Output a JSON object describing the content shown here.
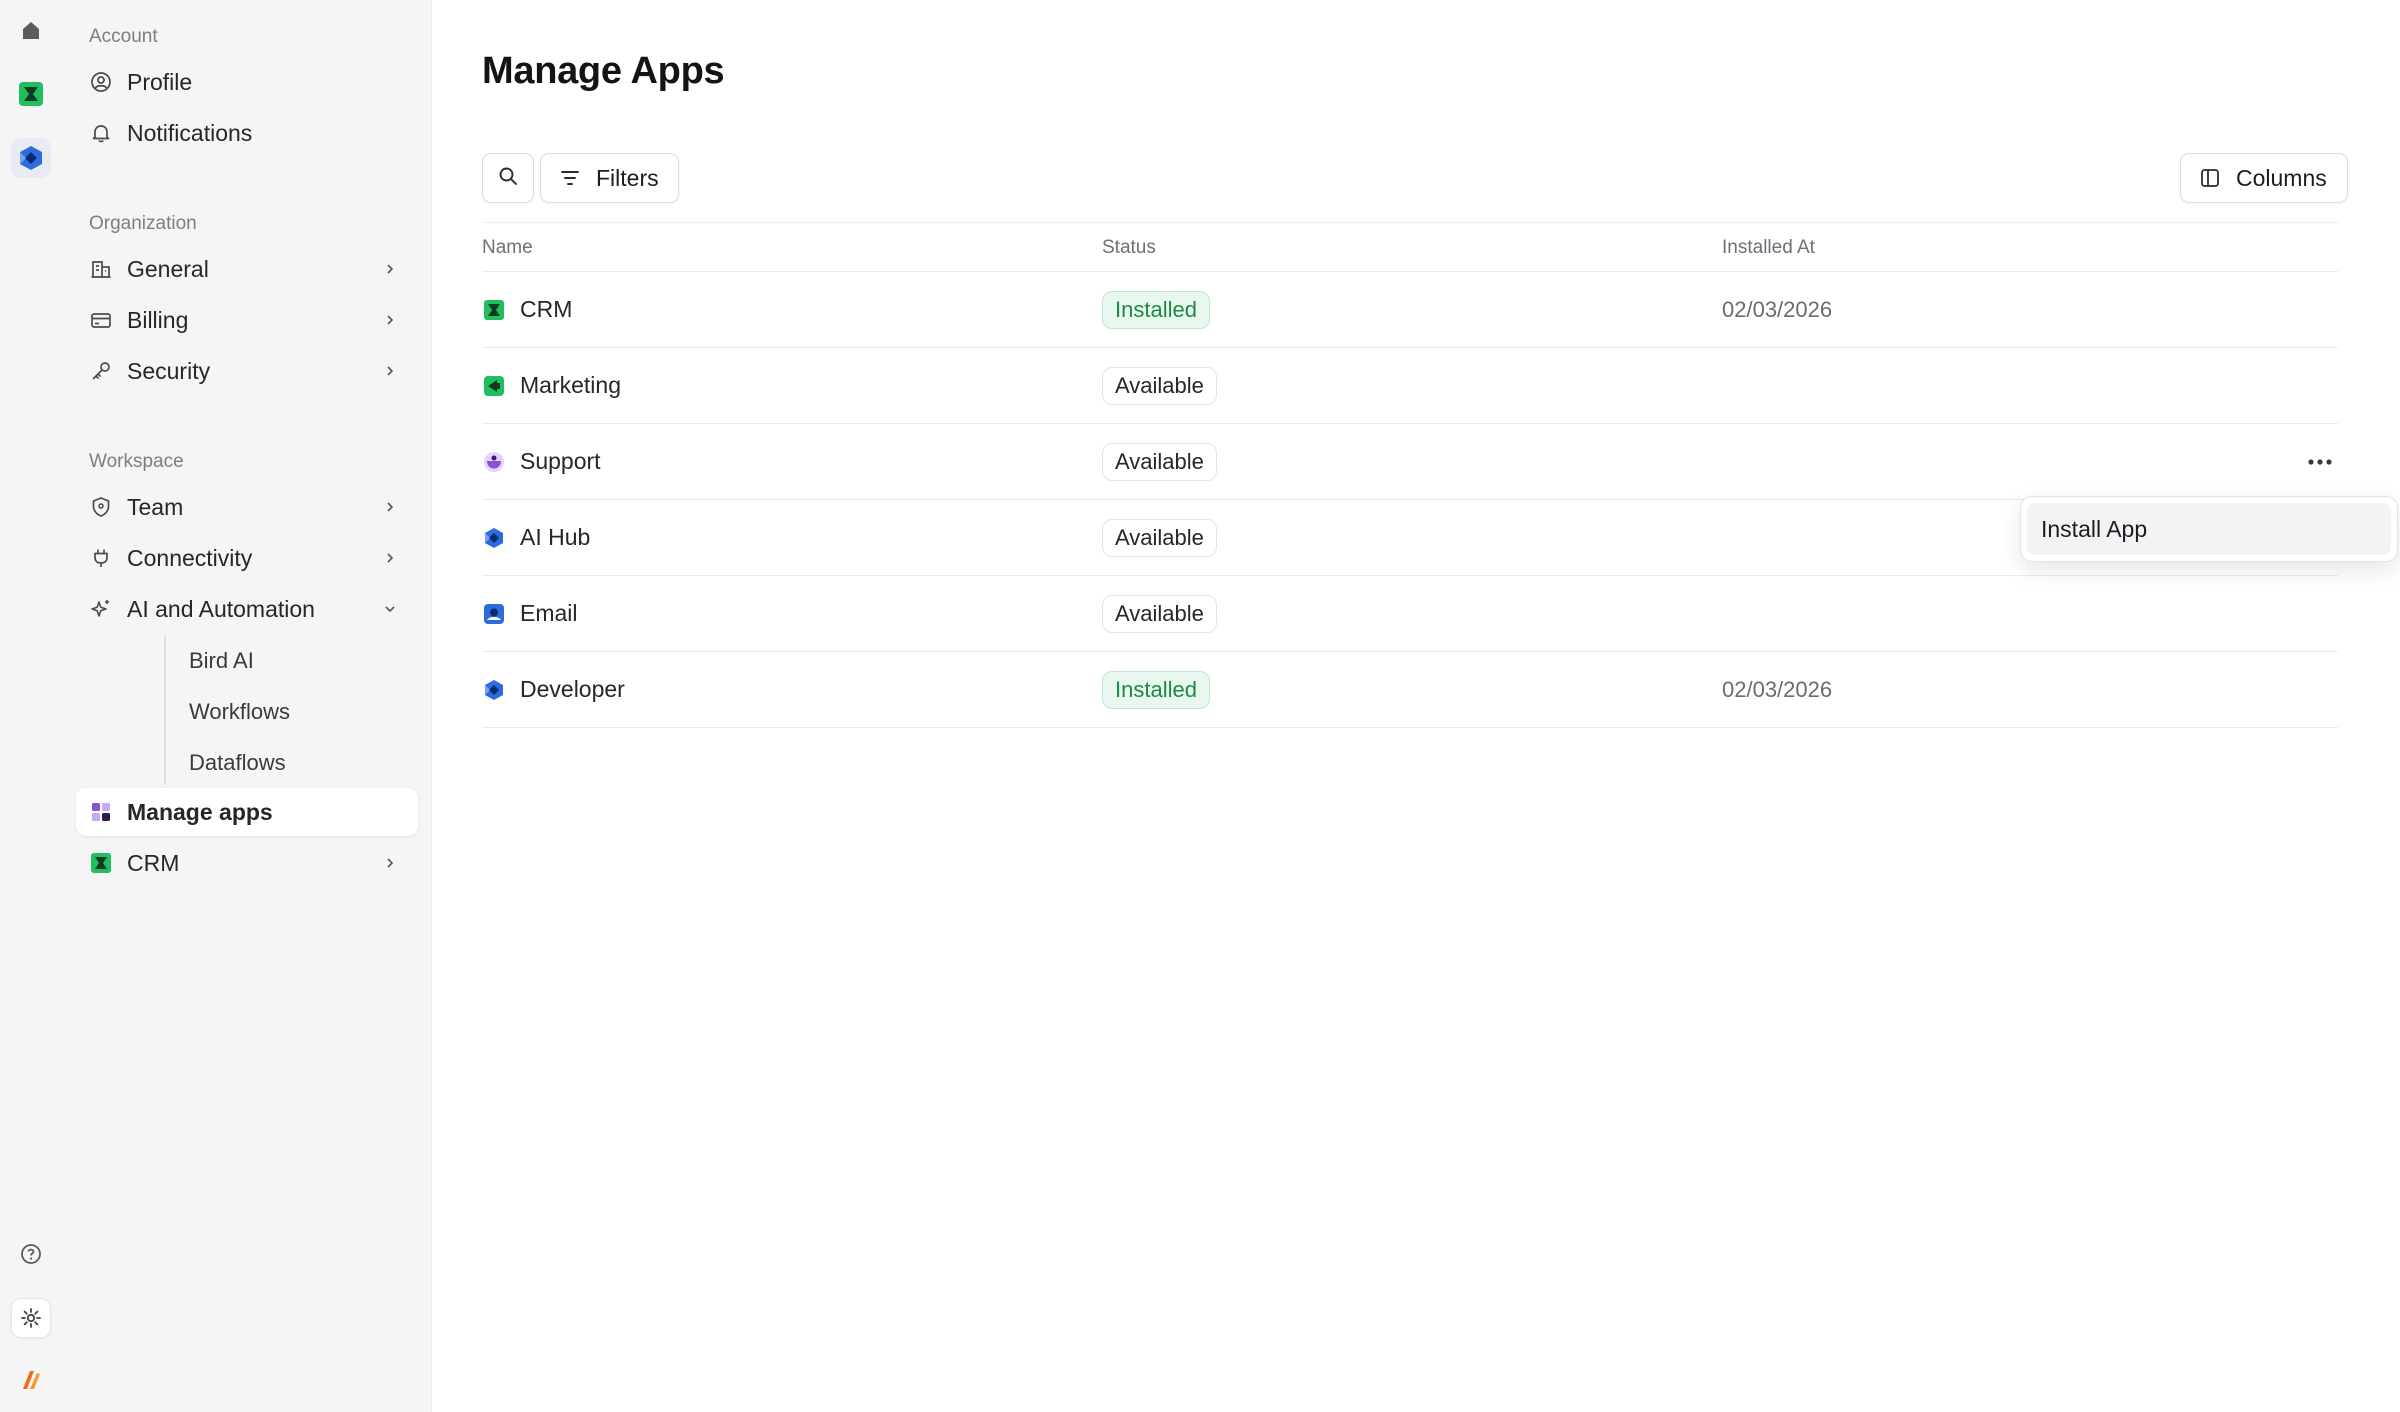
{
  "sidebar": {
    "account_label": "Account",
    "organization_label": "Organization",
    "workspace_label": "Workspace",
    "items": {
      "profile": "Profile",
      "notifications": "Notifications",
      "general": "General",
      "billing": "Billing",
      "security": "Security",
      "team": "Team",
      "connectivity": "Connectivity",
      "ai_automation": "AI and Automation",
      "manage_apps": "Manage apps",
      "crm": "CRM"
    },
    "sub_items": {
      "bird_ai": "Bird AI",
      "workflows": "Workflows",
      "dataflows": "Dataflows"
    }
  },
  "main": {
    "title": "Manage Apps",
    "filters_label": "Filters",
    "columns_label": "Columns",
    "columns": {
      "name": "Name",
      "status": "Status",
      "installed_at": "Installed At"
    },
    "rows": [
      {
        "name": "CRM",
        "status": "Installed",
        "installed_at": "02/03/2026",
        "icon": "crm-app-icon"
      },
      {
        "name": "Marketing",
        "status": "Available",
        "installed_at": "",
        "icon": "marketing-app-icon"
      },
      {
        "name": "Support",
        "status": "Available",
        "installed_at": "",
        "icon": "support-app-icon"
      },
      {
        "name": "AI Hub",
        "status": "Available",
        "installed_at": "",
        "icon": "ai-hub-app-icon"
      },
      {
        "name": "Email",
        "status": "Available",
        "installed_at": "",
        "icon": "email-app-icon"
      },
      {
        "name": "Developer",
        "status": "Installed",
        "installed_at": "02/03/2026",
        "icon": "developer-app-icon"
      }
    ]
  },
  "dropdown": {
    "install_label": "Install App"
  },
  "colors": {
    "installed_text": "#1c8a44",
    "installed_bg": "#e9f8ee",
    "crm_green": "#1fbf5f",
    "brand_blue": "#2d6cdf",
    "support_purple": "#8b4fd8",
    "accent_orange": "#f06a1d"
  }
}
